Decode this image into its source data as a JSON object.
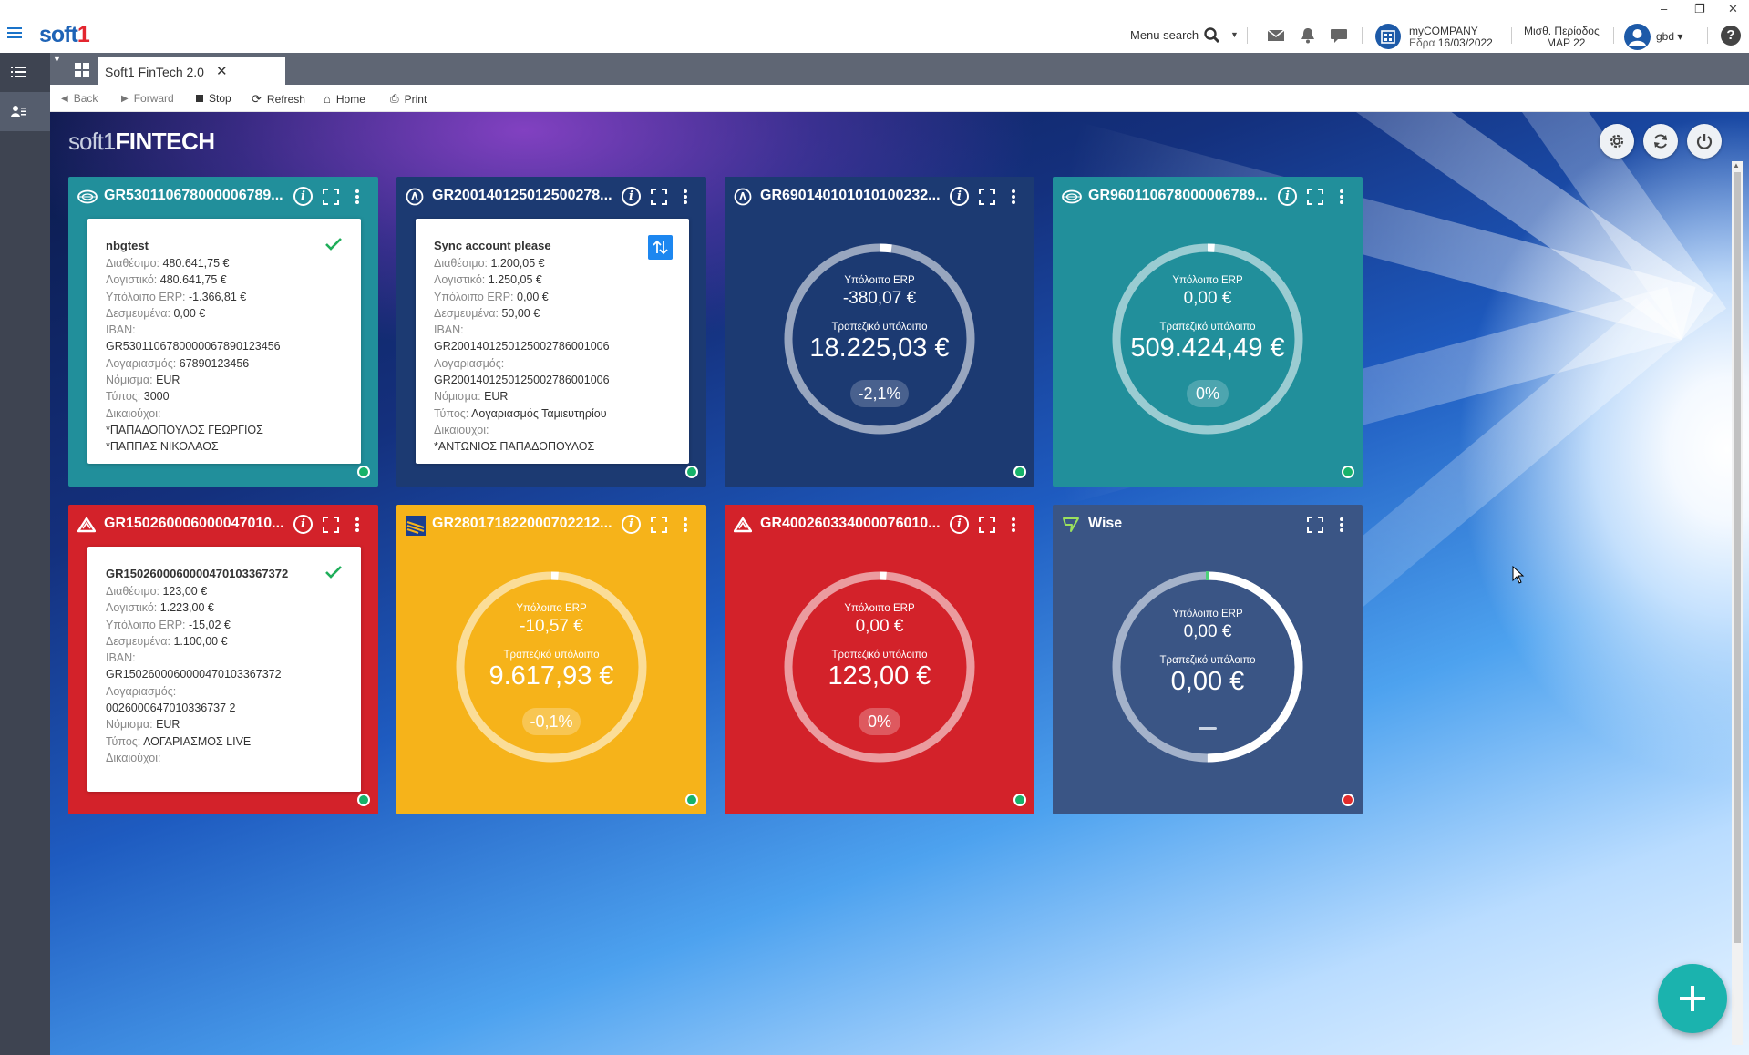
{
  "header": {
    "logo_main": "soft",
    "logo_accent": "1",
    "menu_search": "Menu search",
    "company": "myCOMPANY",
    "company_site_label": "Εδρα",
    "company_date": "16/03/2022",
    "period_label": "Μισθ. Περίοδος",
    "period_value": "ΜΑΡ 22",
    "user": "gbd",
    "help": "?",
    "win_min": "–",
    "win_restore": "❐",
    "win_close": "✕"
  },
  "tabs": [
    {
      "label": "Soft1 FinTech 2.0",
      "close": "✕"
    }
  ],
  "toolbar": {
    "back": "Back",
    "forward": "Forward",
    "stop": "Stop",
    "refresh": "Refresh",
    "home": "Home",
    "print": "Print"
  },
  "app": {
    "logo_soft": "soft1",
    "logo_fintech": "FINTECH"
  },
  "cards": [
    {
      "title": "GR530110678000006789...",
      "color": "#218f9b",
      "bank_icon": "nbg-bank-icon",
      "detail": {
        "name": "nbgtest",
        "status_icon": "check-icon",
        "lines": [
          {
            "k": "Διαθέσιμο:",
            "v": "480.641,75 €"
          },
          {
            "k": "Λογιστικό:",
            "v": "480.641,75 €"
          },
          {
            "k": "Υπόλοιπο ERP:",
            "v": "-1.366,81 €"
          },
          {
            "k": "Δεσμευμένα:",
            "v": "0,00 €"
          },
          {
            "k": "IBAN:",
            "v": ""
          },
          {
            "k": "",
            "v": "GR5301106780000067890123456"
          },
          {
            "k": "Λογαριασμός:",
            "v": "67890123456"
          },
          {
            "k": "Νόμισμα:",
            "v": "EUR"
          },
          {
            "k": "Τύπος:",
            "v": "3000"
          },
          {
            "k": "Δικαιούχοι:",
            "v": ""
          },
          {
            "k": "",
            "v": "*ΠΑΠΑΔΟΠΟΥΛΟΣ ΓΕΩΡΓΙΟΣ"
          },
          {
            "k": "",
            "v": "*ΠΑΠΠΑΣ ΝΙΚΟΛΑΟΣ"
          }
        ]
      },
      "status": "green"
    },
    {
      "title": "GR200140125012500278...",
      "color": "#1c3a72",
      "bank_icon": "alpha-bank-icon",
      "detail": {
        "name": "Sync account please",
        "status_icon": "sync-icon",
        "lines": [
          {
            "k": "Διαθέσιμο:",
            "v": "1.200,05 €"
          },
          {
            "k": "Λογιστικό:",
            "v": "1.250,05 €"
          },
          {
            "k": "Υπόλοιπο ERP:",
            "v": "0,00 €"
          },
          {
            "k": "Δεσμευμένα:",
            "v": "50,00 €"
          },
          {
            "k": "IBAN:",
            "v": ""
          },
          {
            "k": "",
            "v": "GR2001401250125002786001006"
          },
          {
            "k": "Λογαριασμός:",
            "v": ""
          },
          {
            "k": "",
            "v": "GR2001401250125002786001006"
          },
          {
            "k": "Νόμισμα:",
            "v": "EUR"
          },
          {
            "k": "Τύπος:",
            "v": "Λογαριασμός Ταμιευτηρίου"
          },
          {
            "k": "Δικαιούχοι:",
            "v": ""
          },
          {
            "k": "",
            "v": "*ΑΝΤΩΝΙΟΣ ΠΑΠΑΔΟΠΟΥΛΟΣ"
          }
        ]
      },
      "status": "green"
    },
    {
      "title": "GR690140101010100232...",
      "color": "#1c3a72",
      "bank_icon": "alpha-bank-icon",
      "gauge": {
        "erp_label": "Υπόλοιπο ERP",
        "erp": "-380,07 €",
        "bank_label": "Τραπεζικό υπόλοιπο",
        "bank": "18.225,03 €",
        "pct": "-2,1%",
        "fill": 0.021
      },
      "status": "green"
    },
    {
      "title": "GR960110678000006789...",
      "color": "#218f9b",
      "bank_icon": "nbg-bank-icon",
      "gauge": {
        "erp_label": "Υπόλοιπο ERP",
        "erp": "0,00 €",
        "bank_label": "Τραπεζικό υπόλοιπο",
        "bank": "509.424,49 €",
        "pct": "0%",
        "fill": 0
      },
      "status": "green"
    },
    {
      "title": "GR150260006000047010...",
      "color": "#d3222a",
      "bank_icon": "eurobank-icon",
      "detail": {
        "name": "GR1502600060000470103367372",
        "status_icon": "check-icon",
        "lines": [
          {
            "k": "Διαθέσιμο:",
            "v": "123,00 €"
          },
          {
            "k": "Λογιστικό:",
            "v": "1.223,00 €"
          },
          {
            "k": "Υπόλοιπο ERP:",
            "v": "-15,02 €"
          },
          {
            "k": "Δεσμευμένα:",
            "v": "1.100,00 €"
          },
          {
            "k": "IBAN:",
            "v": ""
          },
          {
            "k": "",
            "v": "GR1502600060000470103367372"
          },
          {
            "k": "Λογαριασμός:",
            "v": ""
          },
          {
            "k": "",
            "v": "0026000647010336737 2"
          },
          {
            "k": "Νόμισμα:",
            "v": "EUR"
          },
          {
            "k": "Τύπος:",
            "v": "ΛΟΓΑΡΙΑΣΜΟΣ LIVE"
          },
          {
            "k": "Δικαιούχοι:",
            "v": ""
          }
        ]
      },
      "status": "green"
    },
    {
      "title": "GR280171822000702212...",
      "color": "#f6b31a",
      "bank_icon": "piraeus-bank-icon",
      "gauge": {
        "erp_label": "Υπόλοιπο ERP",
        "erp": "-10,57 €",
        "bank_label": "Τραπεζικό υπόλοιπο",
        "bank": "9.617,93 €",
        "pct": "-0,1%",
        "fill": 0.001
      },
      "status": "green"
    },
    {
      "title": "GR400260334000076010...",
      "color": "#d3222a",
      "bank_icon": "eurobank-icon",
      "gauge": {
        "erp_label": "Υπόλοιπο ERP",
        "erp": "0,00 €",
        "bank_label": "Τραπεζικό υπόλοιπο",
        "bank": "123,00 €",
        "pct": "0%",
        "fill": 0
      },
      "status": "green"
    },
    {
      "title": "Wise",
      "color": "#3a5585",
      "bank_icon": "wise-icon",
      "gauge": {
        "erp_label": "Υπόλοιπο ERP",
        "erp": "0,00 €",
        "bank_label": "Τραπεζικό υπόλοιπο",
        "bank": "0,00 €",
        "pct": "",
        "fill": 0.5
      },
      "status": "red"
    }
  ],
  "fab_label": "+"
}
